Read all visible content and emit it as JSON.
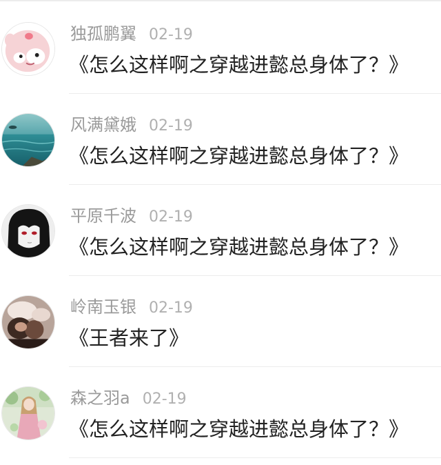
{
  "comments": [
    {
      "avatar_icon": "pink-cartoon-face-avatar-icon",
      "username": "独孤鹏翼",
      "date": "02-19",
      "text": "《怎么这样啊之穿越进懿总身体了？》"
    },
    {
      "avatar_icon": "sea-landscape-avatar-icon",
      "username": "风满黛娥",
      "date": "02-19",
      "text": "《怎么这样啊之穿越进懿总身体了？》"
    },
    {
      "avatar_icon": "dark-haired-anime-avatar-icon",
      "username": "平原千波",
      "date": "02-19",
      "text": "《怎么这样啊之穿越进懿总身体了？》"
    },
    {
      "avatar_icon": "people-photo-avatar-icon",
      "username": "岭南玉银",
      "date": "02-19",
      "text": "《王者来了》"
    },
    {
      "avatar_icon": "girl-illustration-avatar-icon",
      "username": "森之羽a",
      "date": "02-19",
      "text": "《怎么这样啊之穿越进懿总身体了？》"
    }
  ]
}
